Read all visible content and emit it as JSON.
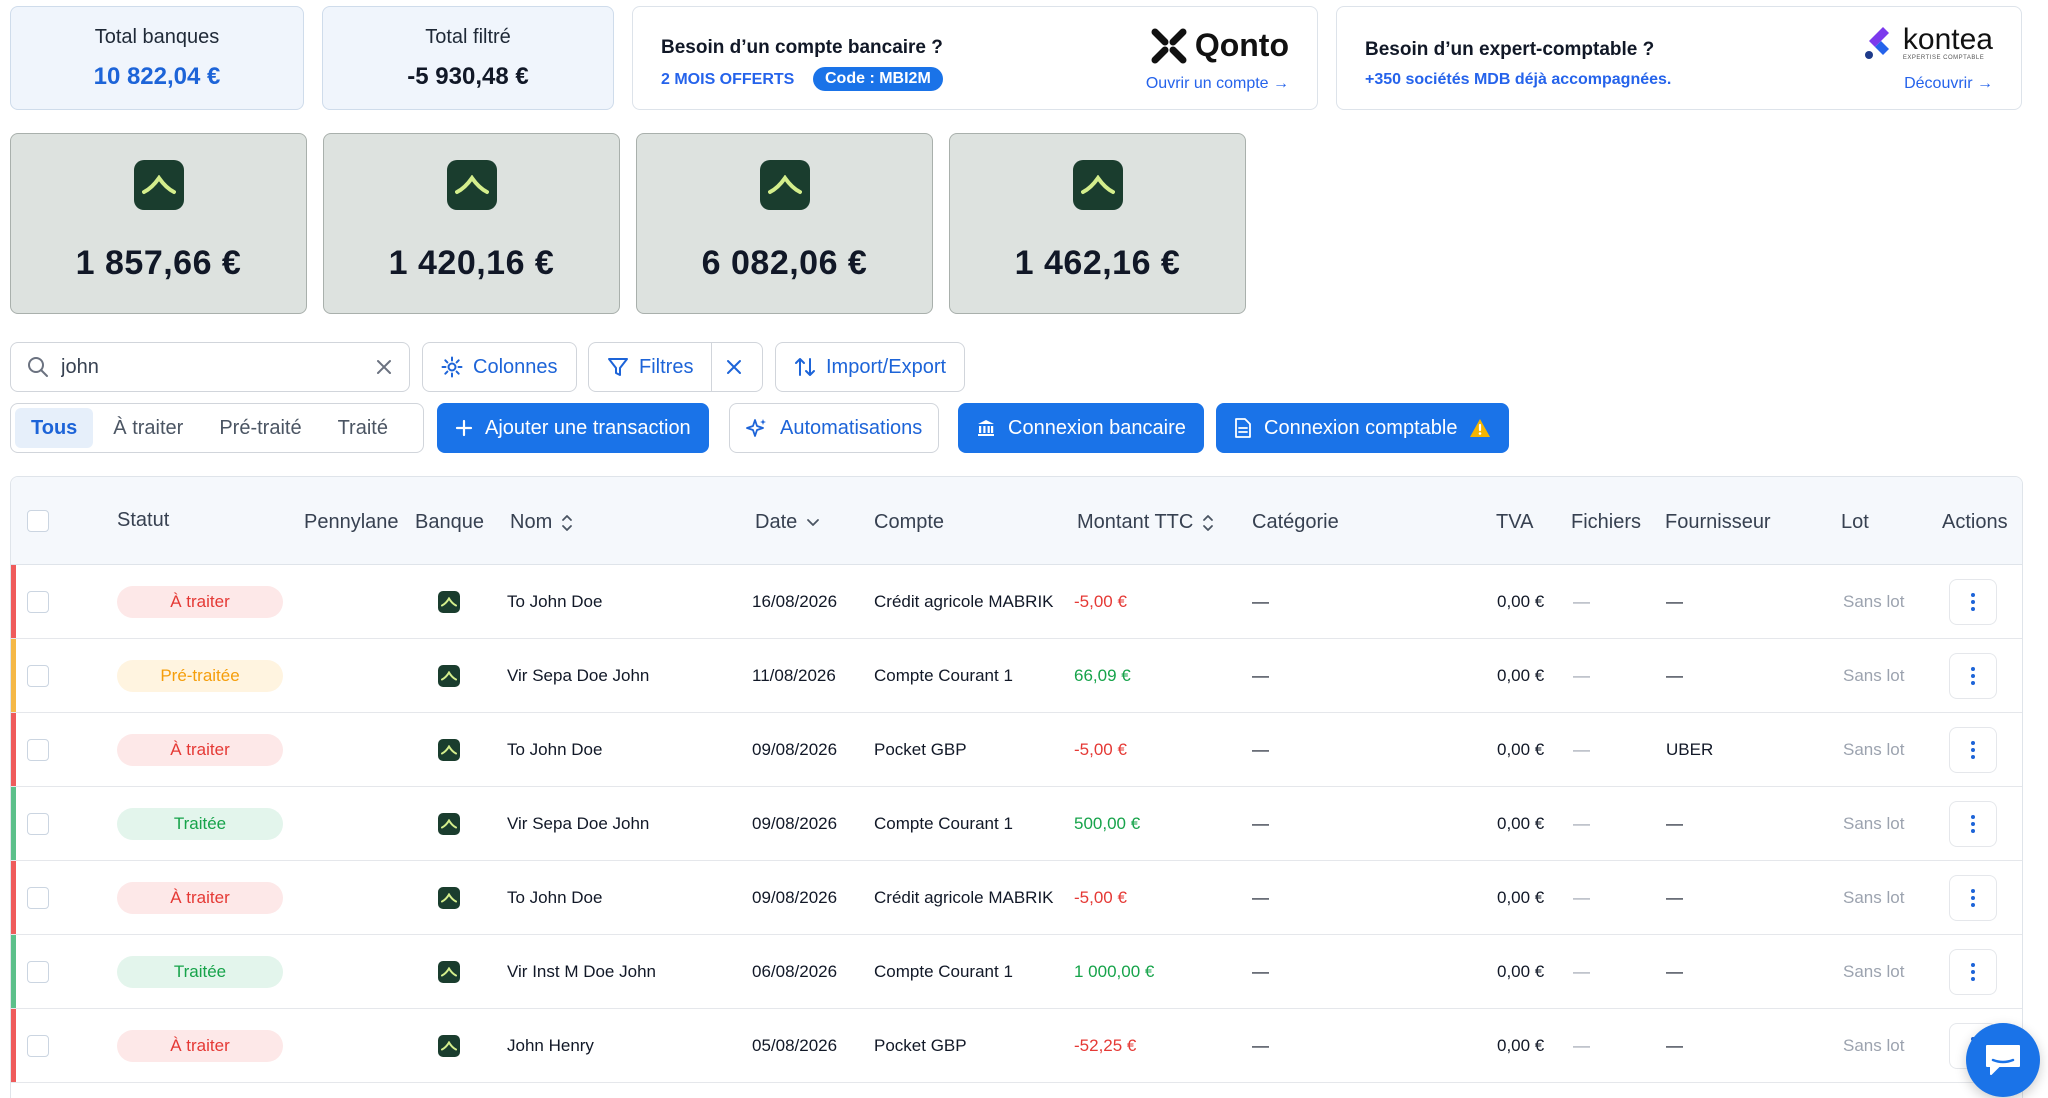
{
  "summary": {
    "total_banques_label": "Total banques",
    "total_banques_value": "10 822,04 €",
    "total_filtre_label": "Total filtré",
    "total_filtre_value": "-5 930,48 €"
  },
  "promo_qonto": {
    "title": "Besoin d’un compte bancaire ?",
    "offer": "2 MOIS OFFERTS",
    "code": "Code : MBI2M",
    "brand": "Qonto",
    "link": "Ouvrir un compte →"
  },
  "promo_kontea": {
    "title": "Besoin d’un expert-comptable ?",
    "sub": "+350 sociétés MDB déjà accompagnées.",
    "brand": "kontea",
    "brand_tagline": "EXPERTISE COMPTABLE",
    "link": "Découvrir →"
  },
  "accounts": [
    {
      "amount": "1 857,66 €"
    },
    {
      "amount": "1 420,16 €"
    },
    {
      "amount": "6 082,06 €"
    },
    {
      "amount": "1 462,16 €"
    }
  ],
  "toolbar": {
    "search_value": "john",
    "columns_label": "Colonnes",
    "filters_label": "Filtres",
    "import_export_label": "Import/Export"
  },
  "segments": {
    "tous": "Tous",
    "a_traiter": "À traiter",
    "pre_traite": "Pré-traité",
    "traite": "Traité"
  },
  "actions": {
    "add_transaction": "Ajouter une transaction",
    "automatisations": "Automatisations",
    "connexion_bancaire": "Connexion bancaire",
    "connexion_comptable": "Connexion comptable"
  },
  "table": {
    "headers": {
      "statut": "Statut",
      "pennylane": "Pennylane",
      "banque": "Banque",
      "nom": "Nom",
      "date": "Date",
      "compte": "Compte",
      "montant": "Montant TTC",
      "categorie": "Catégorie",
      "tva": "TVA",
      "fichiers": "Fichiers",
      "fournisseur": "Fournisseur",
      "lot": "Lot",
      "actions": "Actions"
    },
    "rows": [
      {
        "statut": "À traiter",
        "nom": "To John Doe",
        "date": "16/08/2026",
        "compte": "Crédit agricole MABRIK",
        "montant": "-5,00 €",
        "categorie": "—",
        "tva": "0,00 €",
        "fichiers": "—",
        "fournisseur": "—",
        "lot": "Sans lot"
      },
      {
        "statut": "Pré-traitée",
        "nom": "Vir Sepa Doe John",
        "date": "11/08/2026",
        "compte": "Compte Courant 1",
        "montant": "66,09 €",
        "categorie": "—",
        "tva": "0,00 €",
        "fichiers": "—",
        "fournisseur": "—",
        "lot": "Sans lot"
      },
      {
        "statut": "À traiter",
        "nom": "To John Doe",
        "date": "09/08/2026",
        "compte": "Pocket GBP",
        "montant": "-5,00 €",
        "categorie": "—",
        "tva": "0,00 €",
        "fichiers": "—",
        "fournisseur": "UBER",
        "lot": "Sans lot"
      },
      {
        "statut": "Traitée",
        "nom": "Vir Sepa Doe John",
        "date": "09/08/2026",
        "compte": "Compte Courant 1",
        "montant": "500,00 €",
        "categorie": "—",
        "tva": "0,00 €",
        "fichiers": "—",
        "fournisseur": "—",
        "lot": "Sans lot"
      },
      {
        "statut": "À traiter",
        "nom": "To John Doe",
        "date": "09/08/2026",
        "compte": "Crédit agricole MABRIK",
        "montant": "-5,00 €",
        "categorie": "—",
        "tva": "0,00 €",
        "fichiers": "—",
        "fournisseur": "—",
        "lot": "Sans lot"
      },
      {
        "statut": "Traitée",
        "nom": "Vir Inst M Doe John",
        "date": "06/08/2026",
        "compte": "Compte Courant 1",
        "montant": "1 000,00 €",
        "categorie": "—",
        "tva": "0,00 €",
        "fichiers": "—",
        "fournisseur": "—",
        "lot": "Sans lot"
      },
      {
        "statut": "À traiter",
        "nom": "John Henry",
        "date": "05/08/2026",
        "compte": "Pocket GBP",
        "montant": "-52,25 €",
        "categorie": "—",
        "tva": "0,00 €",
        "fichiers": "—",
        "fournisseur": "—",
        "lot": "Sans lot"
      }
    ]
  },
  "colors": {
    "accent": "#1a73e8",
    "status_a_traiter_bg": "#fde8e8",
    "status_a_traiter_fg": "#e53935",
    "status_pre_traitee_bg": "#fff4e0",
    "status_pre_traitee_fg": "#f59e0b",
    "status_traitee_bg": "#e3f5ec",
    "status_traitee_fg": "#16a34a",
    "amount_negative": "#e53935",
    "amount_positive": "#16a34a"
  },
  "icons": {
    "search": "search-icon",
    "clear": "close-icon",
    "columns": "gear-icon",
    "filters": "funnel-icon",
    "import_export": "arrows-up-down-icon",
    "add": "plus-icon",
    "automatisations": "sparkle-icon",
    "bank": "bank-icon",
    "document": "document-icon",
    "warning": "warning-icon",
    "row_actions": "kebab-menu-icon",
    "chat": "chat-icon"
  }
}
